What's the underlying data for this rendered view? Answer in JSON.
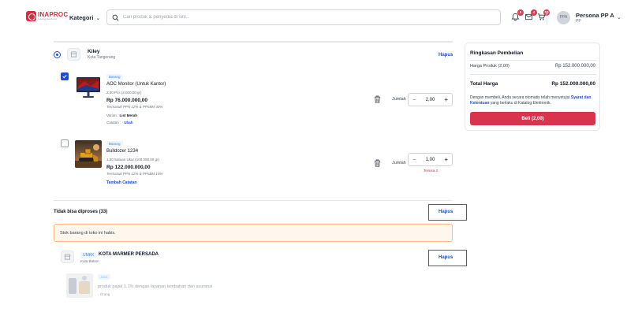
{
  "header": {
    "logo_text": "INAPROC",
    "logo_subtext": "Katalog Elektronik",
    "kategori_label": "Kategori",
    "search_placeholder": "Cari produk & penyedia di sini...",
    "notifications": [
      {
        "icon": "bell-icon",
        "badge": "5"
      },
      {
        "icon": "mail-icon",
        "badge": "4"
      },
      {
        "icon": "cart-icon",
        "badge": "10"
      }
    ],
    "avatar_initials": "PPA",
    "user_name": "Persona PP A",
    "user_role": "PP"
  },
  "cart": {
    "store": {
      "name": "Kiley",
      "city": "Kota Tangerang",
      "delete_label": "Hapus"
    },
    "items": [
      {
        "tag": "Barang",
        "name": "AOC Monitor (Untuk Kantor)",
        "qty_info": "2,00 Pcs (2.000,00 gr)",
        "price": "Rp 76.000.000,00",
        "tax": "Termasuk PPN 12% & PPnBM 40%",
        "variant_label": "Varian",
        "variant_value": "List Merah",
        "note_label": "Catatan",
        "note_value": "- ",
        "note_link": "Ubah",
        "checked": true,
        "jumlah_label": "Jumlah",
        "quantity": "2,00",
        "remaining": ""
      },
      {
        "tag": "Barang",
        "name": "Bulldozer 1234",
        "qty_info": "1,00 Satuan Ukur (100.000,00 gr)",
        "price": "Rp 122.000.000,00",
        "tax": "Termasuk PPN 12% & PPnBM 10%",
        "add_note": "Tambah Catatan",
        "checked": false,
        "jumlah_label": "Jumlah",
        "quantity": "1,00",
        "remaining": "Tersisa 3"
      }
    ]
  },
  "unprocessable": {
    "title": "Tidak bisa diproses (33)",
    "delete_label": "Hapus",
    "warning": "Stok barang di toko ini habis.",
    "store": {
      "badge": "UMKK",
      "name": "KOTA MARMER PERSADA",
      "city": "Kota Batam",
      "delete_label": "Hapus"
    },
    "item": {
      "tag": "Jasa",
      "description": "produk pajak 1,1% dengan layanan tambahan dan asuransi",
      "unit": "- Orang"
    }
  },
  "summary": {
    "title": "Ringkasan Pembelian",
    "product_price_label": "Harga Produk (2,00)",
    "product_price_value": "Rp 152.000.000,00",
    "total_label": "Total Harga",
    "total_value": "Rp 152.000.000,00",
    "terms_prefix": "Dengan membeli, Anda secara otomatis telah menyetujui",
    "terms_link": "Syarat dan Ketentuan",
    "terms_suffix": "yang berlaku di Katalog Elektronik.",
    "buy_label": "Beli (2,00)"
  },
  "colors": {
    "brand": "#d32f3f",
    "accent": "#1d4ed8",
    "buy_button": "#d9334e",
    "warning_bg": "#fff7ed"
  }
}
